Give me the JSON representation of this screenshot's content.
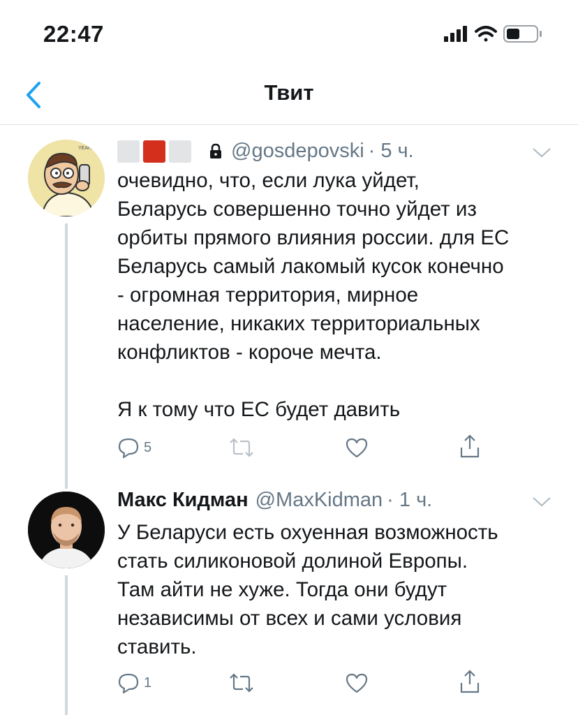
{
  "status_bar": {
    "time": "22:47"
  },
  "nav": {
    "title": "Твит"
  },
  "tweets": [
    {
      "display_name": "",
      "handle": "@gosdepovski",
      "time": "· 5 ч.",
      "avatar_text": "YEAH, SO",
      "text": "очевидно, что, если лука уйдет,\nБеларусь совершенно точно уйдет из\nорбиты прямого влияния россии. для ЕС\nБеларусь самый лакомый кусок конечно\n- огромная территория, мирное\nнаселение, никаких территориальных\nконфликтов - короче мечта.\n\nЯ к тому что ЕС будет давить",
      "reply_count": "5",
      "retweet_count": "",
      "like_count": ""
    },
    {
      "display_name": "Макс Кидман",
      "handle": "@MaxKidman",
      "time": "· 1 ч.",
      "text": "У Беларуси есть охуенная возможность\nстать силиконовой долиной Европы.\nТам айти не хуже. Тогда они будут\nнезависимы от всех и сами условия\nставить.",
      "reply_count": "1",
      "retweet_count": "",
      "like_count": ""
    }
  ],
  "colors": {
    "text": "#14171a",
    "secondary": "#657786",
    "accent": "#1da1f2",
    "flag_red": "#d42e1c"
  },
  "icons": [
    "signal-icon",
    "wifi-icon",
    "battery-icon",
    "back-chevron-icon",
    "lock-icon",
    "caret-down-icon",
    "reply-icon",
    "retweet-icon",
    "like-icon",
    "share-icon"
  ]
}
